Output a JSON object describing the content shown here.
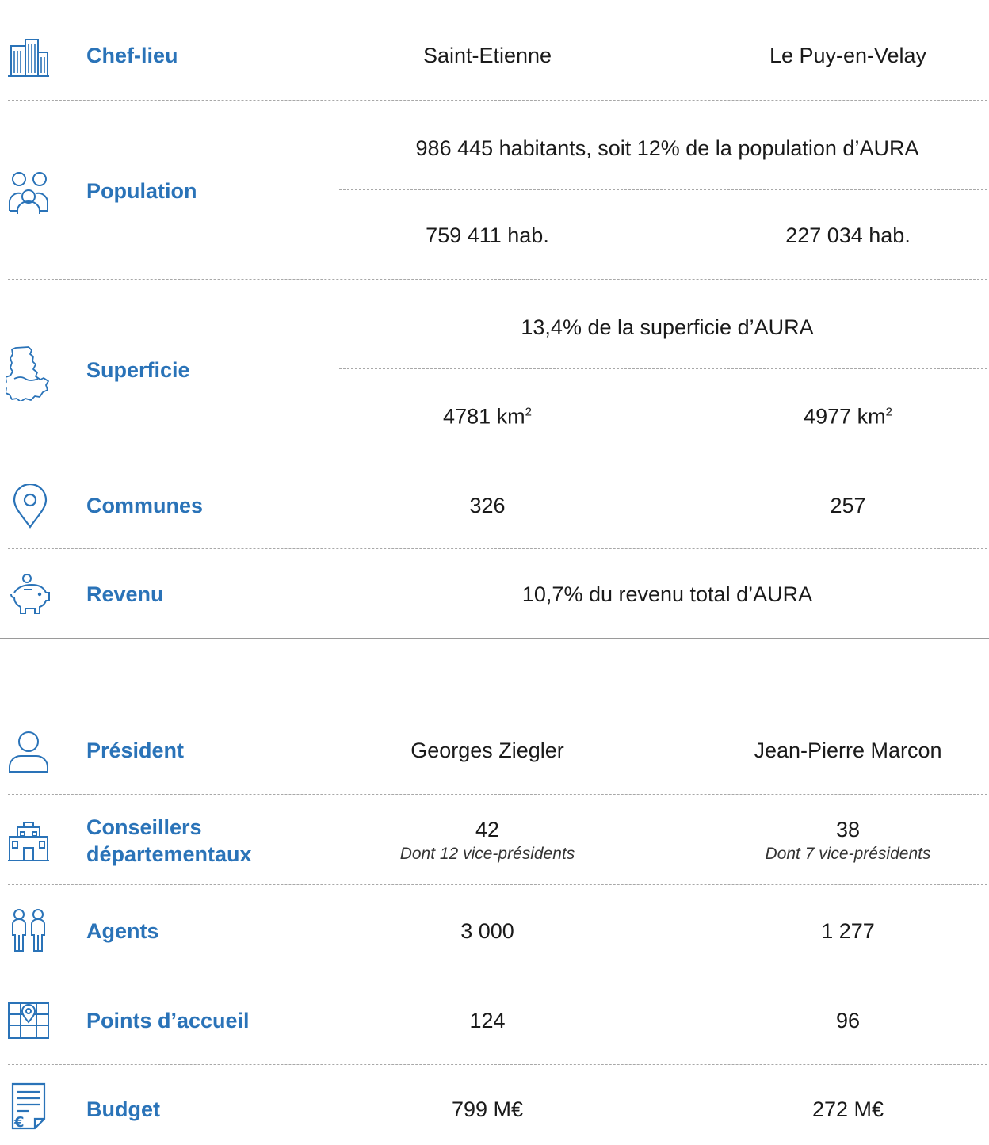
{
  "table1": {
    "chef_lieu": {
      "label": "Chef-lieu",
      "col1": "Saint-Etienne",
      "col2": "Le Puy-en-Velay",
      "icon": "building-icon"
    },
    "population": {
      "label": "Population",
      "total": "986 445 habitants, soit 12% de la population d’AURA",
      "col1": "759 411 hab.",
      "col2": "227 034 hab.",
      "icon": "people-icon"
    },
    "superficie": {
      "label": "Superficie",
      "total": "13,4% de la superficie d’AURA",
      "col1": "4781 km",
      "col2": "4977 km",
      "unit_sup": "2",
      "icon": "map-outline-icon"
    },
    "communes": {
      "label": "Communes",
      "col1": "326",
      "col2": "257",
      "icon": "location-pin-icon"
    },
    "revenu": {
      "label": "Revenu",
      "total": "10,7% du revenu total d’AURA",
      "icon": "piggy-bank-icon"
    }
  },
  "table2": {
    "president": {
      "label": "Président",
      "col1": "Georges Ziegler",
      "col2": "Jean-Pierre Marcon",
      "icon": "person-icon"
    },
    "conseillers": {
      "label_line1": "Conseillers",
      "label_line2": "départementaux",
      "col1": "42",
      "col1_sub": "Dont 12 vice-présidents",
      "col2": "38",
      "col2_sub": "Dont 7 vice-présidents",
      "icon": "government-building-icon"
    },
    "agents": {
      "label": "Agents",
      "col1": "3 000",
      "col2": "1 277",
      "icon": "two-people-icon"
    },
    "points_accueil": {
      "label": "Points d’accueil",
      "col1": "124",
      "col2": "96",
      "icon": "map-pin-icon"
    },
    "budget": {
      "label": "Budget",
      "col1": "799 M€",
      "col2": "272 M€",
      "icon": "euro-document-icon"
    }
  },
  "colors": {
    "accent": "#2a73b8",
    "rule": "#9a9a9a",
    "text": "#1a1a1a"
  }
}
